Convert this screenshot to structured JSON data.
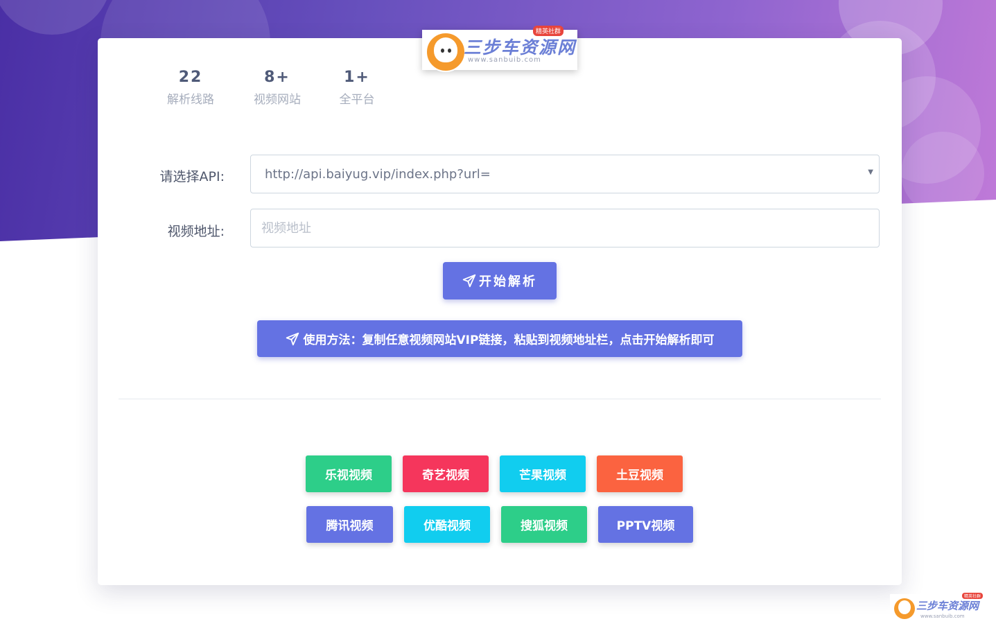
{
  "stats": [
    {
      "num": "22",
      "label": "解析线路"
    },
    {
      "num": "8+",
      "label": "视频网站"
    },
    {
      "num": "1+",
      "label": "全平台"
    }
  ],
  "logo": {
    "title": "三步车资源网",
    "url": "www.sanbuib.com",
    "tag": "精英社群"
  },
  "form": {
    "api_label": "请选择API:",
    "api_selected": "http://api.baiyug.vip/index.php?url=",
    "url_label": "视频地址:",
    "url_placeholder": "视频地址",
    "url_value": ""
  },
  "actions": {
    "parse_label": "开始解析",
    "usage_text": "使用方法：复制任意视频网站VIP链接，粘贴到视频地址栏，点击开始解析即可"
  },
  "video_sites": [
    {
      "label": "乐视视频",
      "color": "#2dce89"
    },
    {
      "label": "奇艺视频",
      "color": "#f5365c"
    },
    {
      "label": "芒果视频",
      "color": "#11cdef"
    },
    {
      "label": "土豆视频",
      "color": "#fb6340"
    },
    {
      "label": "腾讯视频",
      "color": "#6472e3"
    },
    {
      "label": "优酷视频",
      "color": "#11cdef"
    },
    {
      "label": "搜狐视频",
      "color": "#2dce89"
    },
    {
      "label": "PPTV视频",
      "color": "#6472e3"
    }
  ],
  "colors": {
    "primary": "#6472e3",
    "hero_start": "#4a2fa5",
    "hero_end": "#c07ad8"
  }
}
